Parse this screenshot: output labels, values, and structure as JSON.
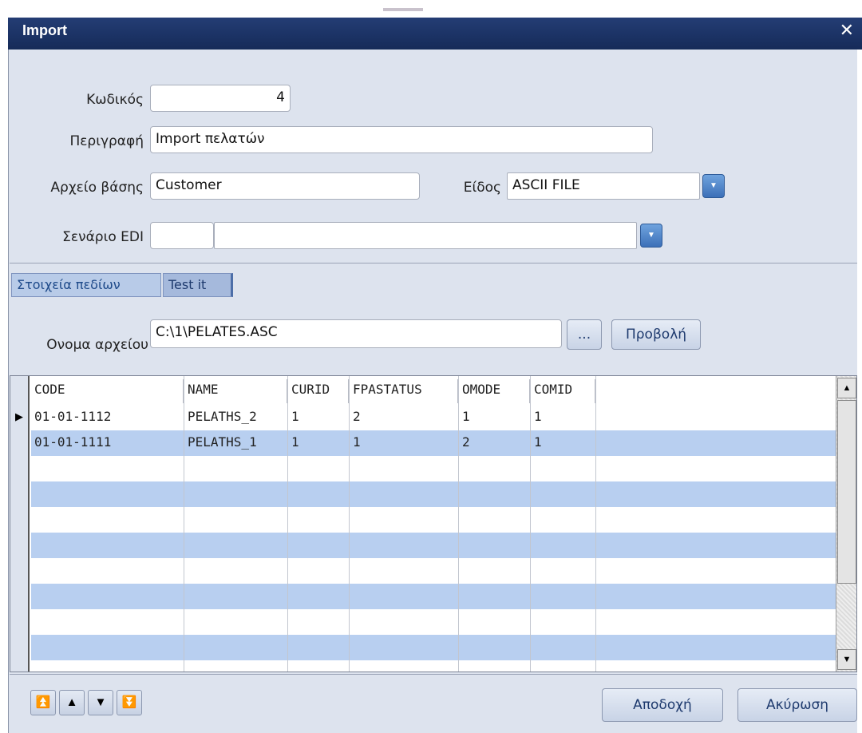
{
  "window": {
    "title": "Import"
  },
  "form": {
    "code_label": "Κωδικός",
    "code_value": "4",
    "desc_label": "Περιγραφή",
    "desc_value": "Import πελατών",
    "basefile_label": "Αρχείο βάσης",
    "basefile_value": "Customer",
    "type_label": "Είδος",
    "type_value": "ASCII FILE",
    "edi_label": "Σενάριο EDI",
    "edi_code_value": "",
    "edi_name_value": ""
  },
  "tabs": [
    {
      "label": "Στοιχεία πεδίων"
    },
    {
      "label": "Test it"
    }
  ],
  "file": {
    "label": "Ονομα αρχείου",
    "value": "C:\\1\\PELATES.ASC",
    "browse_label": "...",
    "view_label": "Προβολή"
  },
  "grid": {
    "columns": [
      "CODE",
      "NAME",
      "CURID",
      "FPASTATUS",
      "OMODE",
      "COMID"
    ],
    "rows": [
      [
        "01-01-1112",
        "PELATHS_2",
        "1",
        "2",
        "1",
        "1"
      ],
      [
        "01-01-1111",
        "PELATHS_1",
        "1",
        "1",
        "2",
        "1"
      ]
    ]
  },
  "footer": {
    "accept_label": "Αποδοχή",
    "cancel_label": "Ακύρωση"
  }
}
